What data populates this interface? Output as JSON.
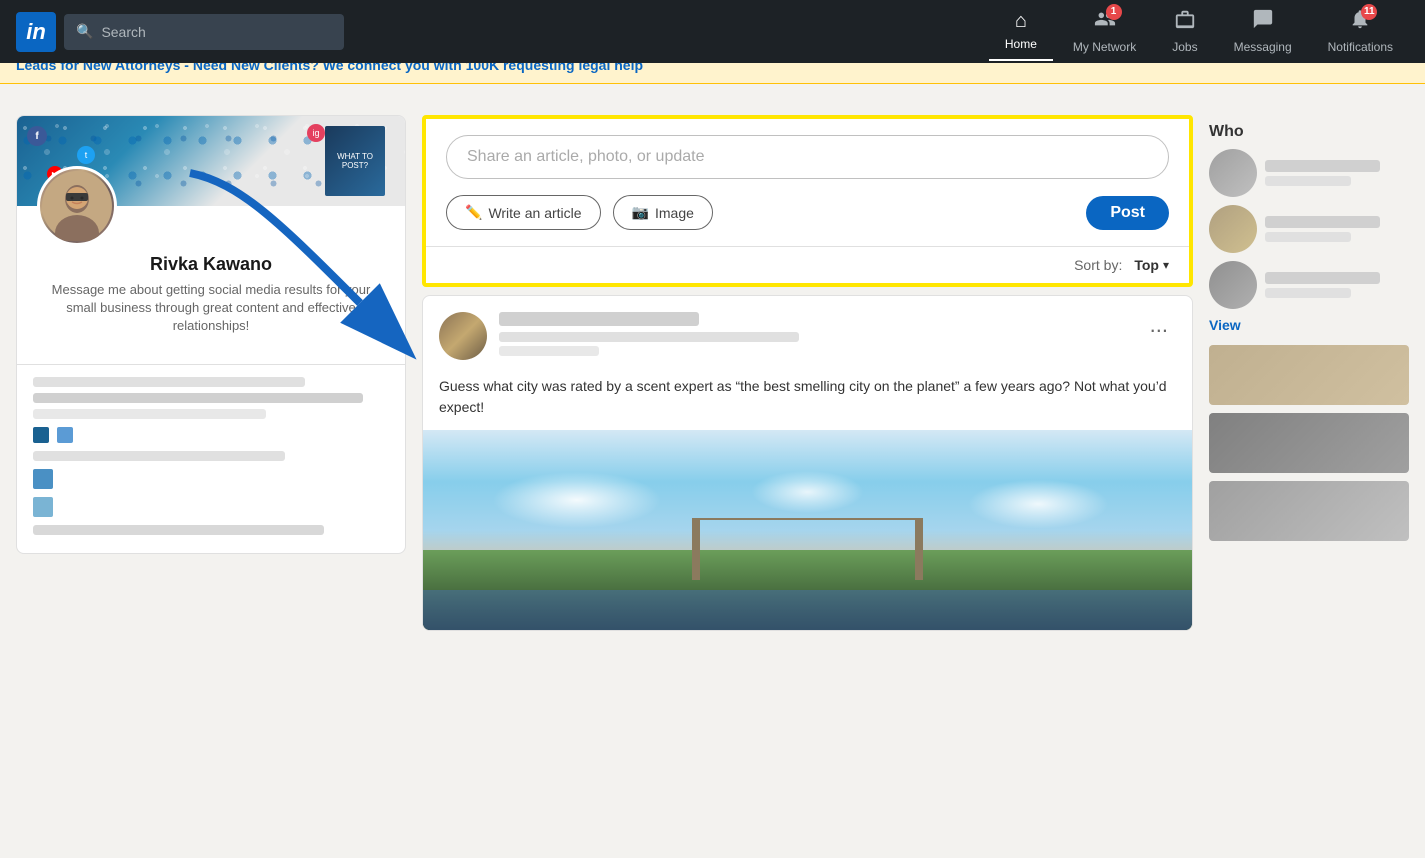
{
  "navbar": {
    "logo": "in",
    "search_placeholder": "Search",
    "nav_items": [
      {
        "id": "home",
        "label": "Home",
        "icon": "🏠",
        "active": true,
        "badge": null
      },
      {
        "id": "my-network",
        "label": "My Network",
        "icon": "👥",
        "active": false,
        "badge": "1"
      },
      {
        "id": "jobs",
        "label": "Jobs",
        "icon": "💼",
        "active": false,
        "badge": null
      },
      {
        "id": "messaging",
        "label": "Messaging",
        "icon": "💬",
        "active": false,
        "badge": null
      },
      {
        "id": "notifications",
        "label": "Notifications",
        "icon": "🔔",
        "active": false,
        "badge": "11"
      }
    ]
  },
  "ad_banner": {
    "text": "Leads for New Attorneys - Need New Clients? We connect you with 100K requesting legal help"
  },
  "left_sidebar": {
    "profile": {
      "name": "Rivka Kawano",
      "bio": "Message me about getting social media results for your small business through great content and effective relationships!"
    }
  },
  "share_box": {
    "placeholder": "Share an article, photo, or update",
    "write_article_label": "Write an article",
    "image_label": "Image",
    "post_label": "Post",
    "sort_label": "Sort by:",
    "sort_value": "Top"
  },
  "post": {
    "text": "Guess what city was rated by a scent expert as “the best smelling city on the planet” a few years ago? Not what you’d expect!",
    "more_icon": "..."
  },
  "right_panel": {
    "header": "Who",
    "view_all": "View"
  },
  "colors": {
    "linkedin_blue": "#0a66c2",
    "highlight_yellow": "#FFE600",
    "arrow_blue": "#1565c0",
    "navbar_bg": "#1d2226"
  }
}
